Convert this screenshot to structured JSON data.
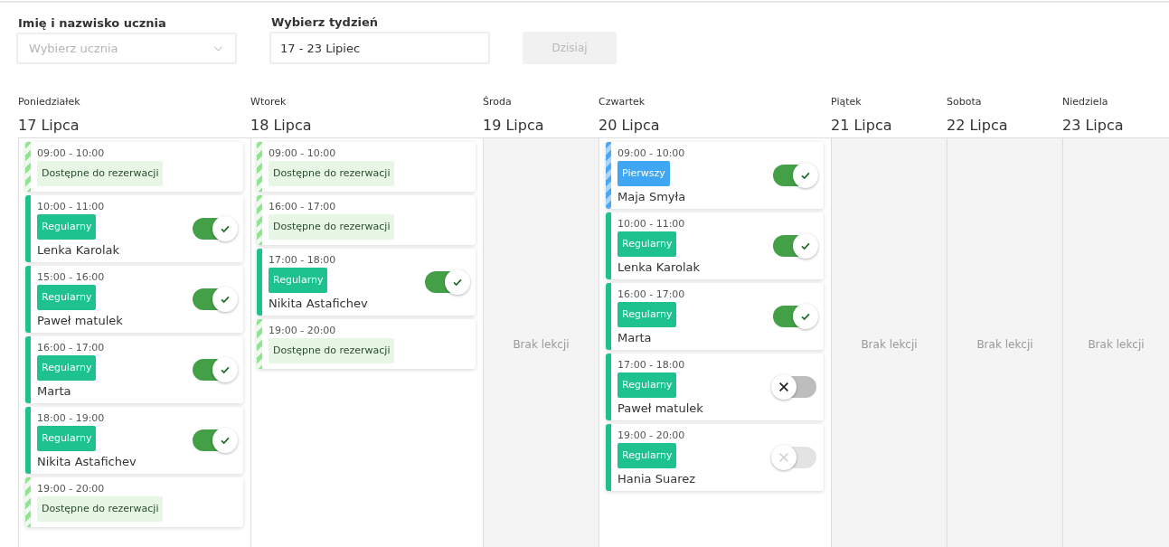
{
  "filters": {
    "student": {
      "label": "Imię i nazwisko ucznia",
      "placeholder": "Wybierz ucznia"
    },
    "week": {
      "label": "Wybierz tydzień",
      "value": "17 - 23 Lipiec"
    },
    "today_button": {
      "label": "Dzisiaj",
      "disabled": true
    }
  },
  "days": [
    {
      "name": "Poniedziałek",
      "date": "17 Lipca",
      "lessons": [
        {
          "kind": "available",
          "time": "09:00 - 10:00",
          "tag": "Dostępne do rezerwacji"
        },
        {
          "kind": "regular",
          "time": "10:00 - 11:00",
          "tag": "Regularny",
          "student": "Lenka Karolak",
          "confirmed": true,
          "disabled": false
        },
        {
          "kind": "regular",
          "time": "15:00 - 16:00",
          "tag": "Regularny",
          "student": "Paweł matulek",
          "confirmed": true,
          "disabled": false
        },
        {
          "kind": "regular",
          "time": "16:00 - 17:00",
          "tag": "Regularny",
          "student": "Marta",
          "confirmed": true,
          "disabled": false
        },
        {
          "kind": "regular",
          "time": "18:00 - 19:00",
          "tag": "Regularny",
          "student": "Nikita Astafichev",
          "confirmed": true,
          "disabled": false
        },
        {
          "kind": "available",
          "time": "19:00 - 20:00",
          "tag": "Dostępne do rezerwacji"
        }
      ]
    },
    {
      "name": "Wtorek",
      "date": "18 Lipca",
      "lessons": [
        {
          "kind": "available",
          "time": "09:00 - 10:00",
          "tag": "Dostępne do rezerwacji"
        },
        {
          "kind": "available",
          "time": "16:00 - 17:00",
          "tag": "Dostępne do rezerwacji"
        },
        {
          "kind": "regular",
          "time": "17:00 - 18:00",
          "tag": "Regularny",
          "student": "Nikita Astafichev",
          "confirmed": true,
          "disabled": false
        },
        {
          "kind": "available",
          "time": "19:00 - 20:00",
          "tag": "Dostępne do rezerwacji"
        }
      ]
    },
    {
      "name": "Środa",
      "date": "19 Lipca",
      "empty_text": "Brak lekcji"
    },
    {
      "name": "Czwartek",
      "date": "20 Lipca",
      "lessons": [
        {
          "kind": "first",
          "time": "09:00 - 10:00",
          "tag": "Pierwszy",
          "student": "Maja Smyła",
          "confirmed": true,
          "disabled": false
        },
        {
          "kind": "regular",
          "time": "10:00 - 11:00",
          "tag": "Regularny",
          "student": "Lenka Karolak",
          "confirmed": true,
          "disabled": false
        },
        {
          "kind": "regular",
          "time": "16:00 - 17:00",
          "tag": "Regularny",
          "student": "Marta",
          "confirmed": true,
          "disabled": false
        },
        {
          "kind": "regular",
          "time": "17:00 - 18:00",
          "tag": "Regularny",
          "student": "Paweł matulek",
          "confirmed": false,
          "disabled": false
        },
        {
          "kind": "regular",
          "time": "19:00 - 20:00",
          "tag": "Regularny",
          "student": "Hania Suarez",
          "confirmed": false,
          "disabled": true
        }
      ]
    },
    {
      "name": "Piątek",
      "date": "21 Lipca",
      "empty_text": "Brak lekcji"
    },
    {
      "name": "Sobota",
      "date": "22 Lipca",
      "empty_text": "Brak lekcji"
    },
    {
      "name": "Niedziela",
      "date": "23 Lipca",
      "empty_text": "Brak lekcji"
    }
  ]
}
